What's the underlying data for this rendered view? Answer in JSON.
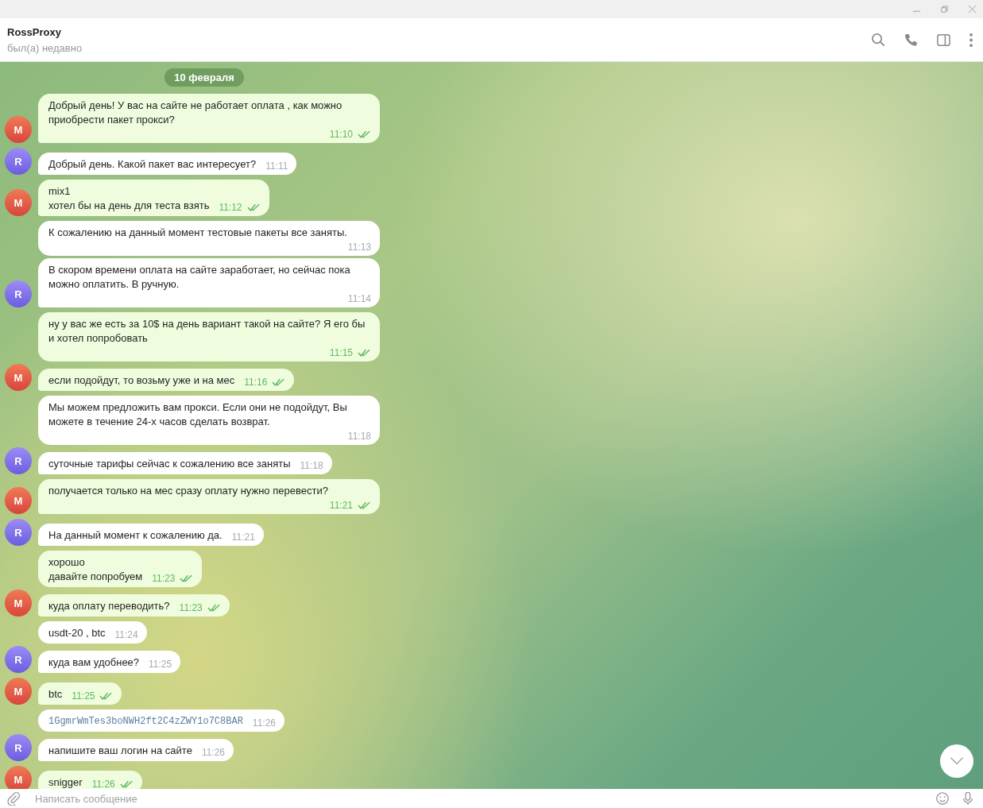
{
  "header": {
    "title": "RossProxy",
    "status": "был(а) недавно"
  },
  "date_pill": "10 февраля",
  "messages": [
    {
      "outgoing": true,
      "avatar": "M",
      "kind": "text",
      "text": "Добрый день! У вас на сайте не работает оплата , как можно приобрести пакет прокси?",
      "time": "11:10",
      "read": true
    },
    {
      "outgoing": false,
      "avatar": "R",
      "kind": "text",
      "text": "Добрый день. Какой пакет вас интересует?",
      "time": "11:11"
    },
    {
      "outgoing": true,
      "avatar": "M",
      "kind": "text",
      "text": "mix1\nхотел бы на день для теста взять",
      "time": "11:12",
      "read": true
    },
    {
      "outgoing": false,
      "kind": "text",
      "text": "К сожалению на данный момент тестовые пакеты все заняты.",
      "time": "11:13"
    },
    {
      "outgoing": false,
      "avatar": "R",
      "kind": "text",
      "text": "В скором времени оплата на сайте заработает, но сейчас пока можно оплатить. В ручную.",
      "time": "11:14"
    },
    {
      "outgoing": true,
      "kind": "text",
      "text": "ну у вас же есть за 10$ на день вариант такой на сайте? Я его бы и хотел попробовать",
      "time": "11:15",
      "read": true
    },
    {
      "outgoing": true,
      "avatar": "M",
      "kind": "text",
      "text": "если подойдут, то возьму уже и на мес",
      "time": "11:16",
      "read": true
    },
    {
      "outgoing": false,
      "kind": "text",
      "text": "Мы можем предложить вам прокси. Если они не подойдут, Вы можете в течение 24-х часов сделать возврат.",
      "time": "11:18"
    },
    {
      "outgoing": false,
      "avatar": "R",
      "kind": "text",
      "text": "суточные тарифы сейчас к сожалению все заняты",
      "time": "11:18"
    },
    {
      "outgoing": true,
      "avatar": "M",
      "kind": "text",
      "text": "получается только на мес сразу оплату нужно перевести?",
      "time": "11:21",
      "read": true
    },
    {
      "outgoing": false,
      "avatar": "R",
      "kind": "text",
      "text": "На данный момент к сожалению да.",
      "time": "11:21"
    },
    {
      "outgoing": true,
      "kind": "text",
      "text": "хорошо\nдавайте попробуем",
      "time": "11:23",
      "read": true
    },
    {
      "outgoing": true,
      "avatar": "M",
      "kind": "text",
      "text": "куда оплату переводить?",
      "time": "11:23",
      "read": true
    },
    {
      "outgoing": false,
      "kind": "text",
      "text": "usdt-20 , btc",
      "time": "11:24"
    },
    {
      "outgoing": false,
      "avatar": "R",
      "kind": "text",
      "text": "куда вам удобнее?",
      "time": "11:25"
    },
    {
      "outgoing": true,
      "avatar": "M",
      "kind": "text",
      "text": "btc",
      "time": "11:25",
      "read": true
    },
    {
      "outgoing": false,
      "kind": "code",
      "text": "1GgmrWmTes3boNWH2ft2C4zZWY1o7C8BAR",
      "time": "11:26"
    },
    {
      "outgoing": false,
      "avatar": "R",
      "kind": "text",
      "text": "напишите ваш логин на сайте",
      "time": "11:26"
    },
    {
      "outgoing": true,
      "avatar": "M",
      "kind": "text",
      "text": "snigger",
      "time": "11:26",
      "read": true
    }
  ],
  "composer": {
    "placeholder": "Написать сообщение"
  }
}
